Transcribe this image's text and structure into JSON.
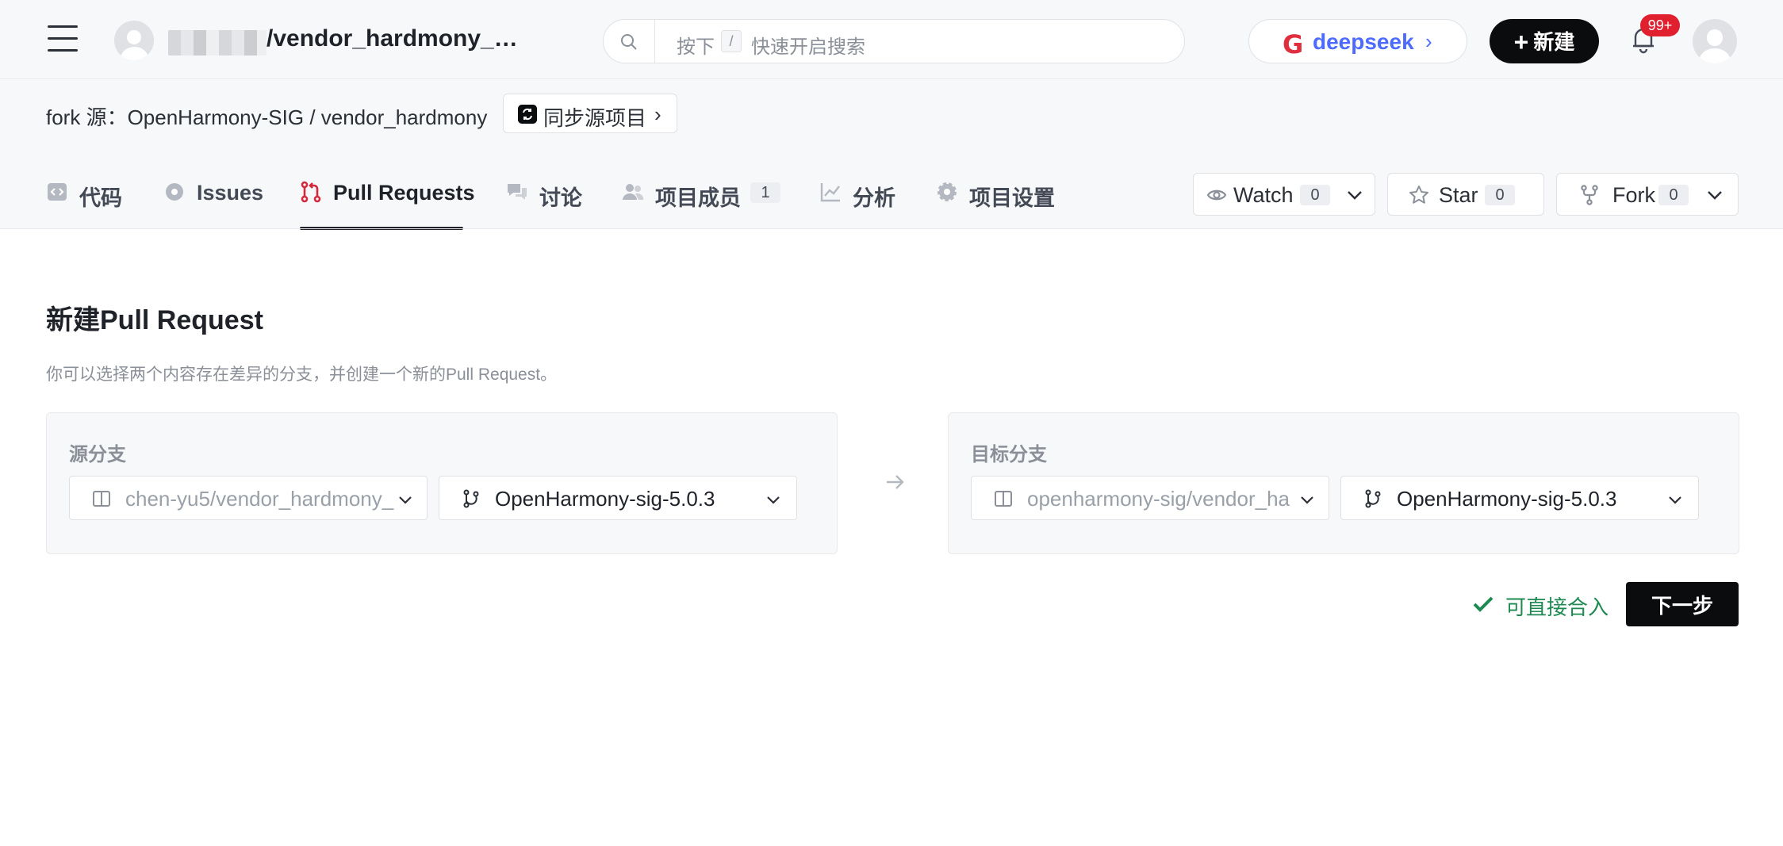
{
  "header": {
    "repo_title": "/vendor_hardmony_…",
    "search": {
      "placeholder_press": "按下",
      "shortcut_key": "/",
      "placeholder_text": "快速开启搜索"
    },
    "deepseek": {
      "logo_letter": "G",
      "label": "deepseek",
      "arrow": "›"
    },
    "new_button": {
      "plus": "+",
      "label": "新建"
    },
    "notifications_badge": "99+"
  },
  "fork_info": {
    "text": "fork 源：OpenHarmony-SIG / vendor_hardmony",
    "sync_button": "同步源项目",
    "sync_chevron": "›"
  },
  "tabs": [
    {
      "label": "代码",
      "icon": "code-icon"
    },
    {
      "label": "Issues",
      "icon": "issues-icon"
    },
    {
      "label": "Pull Requests",
      "icon": "pull-request-icon",
      "active": true
    },
    {
      "label": "讨论",
      "icon": "discussion-icon"
    },
    {
      "label": "项目成员",
      "icon": "members-icon",
      "count": "1"
    },
    {
      "label": "分析",
      "icon": "analytics-icon"
    },
    {
      "label": "项目设置",
      "icon": "settings-icon"
    }
  ],
  "actions": {
    "watch": {
      "label": "Watch",
      "count": "0"
    },
    "star": {
      "label": "Star",
      "count": "0"
    },
    "fork": {
      "label": "Fork",
      "count": "0"
    }
  },
  "main": {
    "title": "新建Pull Request",
    "description": "你可以选择两个内容存在差异的分支，并创建一个新的Pull Request。",
    "source": {
      "label": "源分支",
      "repo": "chen-yu5/vendor_hardmony_",
      "branch": "OpenHarmony-sig-5.0.3"
    },
    "target": {
      "label": "目标分支",
      "repo": "openharmony-sig/vendor_ha",
      "branch": "OpenHarmony-sig-5.0.3"
    },
    "status": "可直接合入",
    "next_button": "下一步"
  },
  "colors": {
    "primary_button": "#0b0c0e",
    "success": "#1e8a52",
    "badge": "#e0202f",
    "deepseek_blue": "#4d6bfe",
    "deepseek_red": "#e02e3e",
    "pr_icon": "#d4283c"
  }
}
